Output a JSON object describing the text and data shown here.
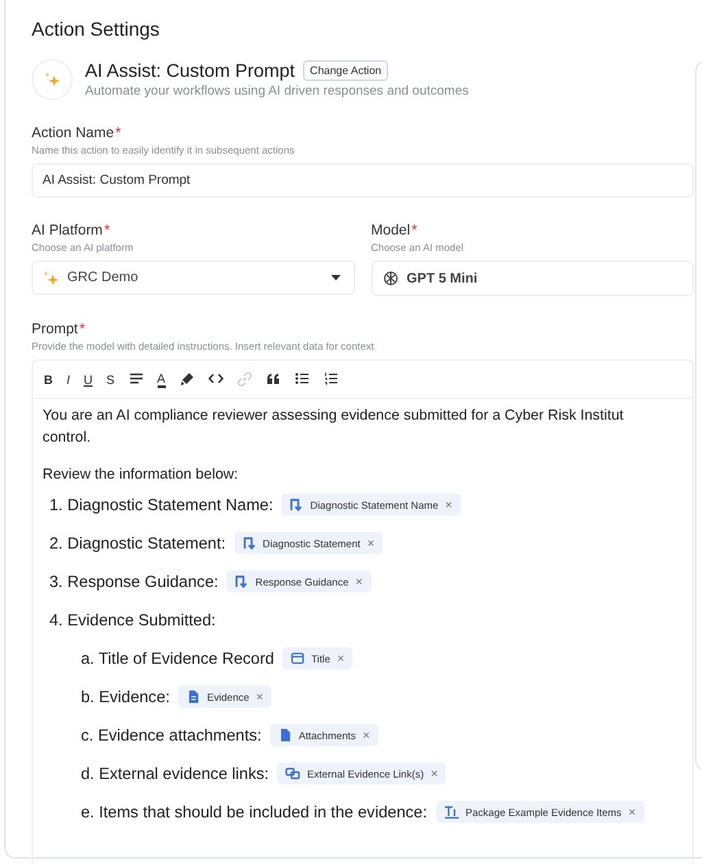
{
  "panel": {
    "title": "Action Settings"
  },
  "action": {
    "title": "AI Assist: Custom Prompt",
    "change_button": "Change Action",
    "description": "Automate your workflows using AI driven responses and outcomes"
  },
  "action_name": {
    "label": "Action Name",
    "required_mark": "*",
    "helper": "Name this action to easily identify it in subsequent actions",
    "value": "AI Assist: Custom Prompt"
  },
  "selectors": [
    {
      "kind": "select",
      "label": "AI Platform",
      "required_mark": "*",
      "helper": "Choose an AI platform",
      "value": "GRC Demo"
    },
    {
      "kind": "text",
      "label": "Model",
      "required_mark": "*",
      "helper": "Choose an AI model",
      "value": "GPT 5 Mini"
    }
  ],
  "prompt": {
    "label": "Prompt",
    "required_mark": "*",
    "helper": "Provide the model with detailed instructions. Insert relevant data for context",
    "toolbar": [
      {
        "kind": "bold",
        "label": "B",
        "disabled": false
      },
      {
        "kind": "italic",
        "label": "I",
        "disabled": false
      },
      {
        "kind": "underline",
        "label": "U",
        "disabled": false
      },
      {
        "kind": "strike",
        "label": "S",
        "disabled": false
      },
      {
        "kind": "align",
        "disabled": false
      },
      {
        "kind": "color",
        "label": "A",
        "disabled": false
      },
      {
        "kind": "highlight",
        "disabled": false
      },
      {
        "kind": "code",
        "disabled": false
      },
      {
        "kind": "link",
        "disabled": true
      },
      {
        "kind": "quote",
        "disabled": false
      },
      {
        "kind": "bullets",
        "disabled": false
      },
      {
        "kind": "numbers",
        "disabled": false
      }
    ],
    "intro": [
      "You are an AI compliance reviewer assessing evidence submitted for a Cyber Risk Institut",
      "control."
    ],
    "lead": "Review the information below:",
    "items": [
      {
        "marker": "1.",
        "text": "Diagnostic Statement Name:",
        "chip": {
          "kind": "lookup",
          "label": "Diagnostic Statement Name",
          "remove": "×"
        }
      },
      {
        "marker": "2.",
        "text": "Diagnostic Statement:",
        "chip": {
          "kind": "lookup",
          "label": "Diagnostic Statement",
          "remove": "×"
        }
      },
      {
        "marker": "3.",
        "text": "Response Guidance:",
        "chip": {
          "kind": "lookup",
          "label": "Response Guidance",
          "remove": "×"
        }
      },
      {
        "marker": "4.",
        "text": "Evidence Submitted:",
        "children": [
          {
            "marker": "a.",
            "text": "Title of Evidence Record",
            "chip": {
              "kind": "window",
              "label": "Title",
              "remove": "×"
            }
          },
          {
            "marker": "b.",
            "text": "Evidence:",
            "chip": {
              "kind": "document",
              "label": "Evidence",
              "remove": "×"
            }
          },
          {
            "marker": "c.",
            "text": "Evidence attachments:",
            "chip": {
              "kind": "file",
              "label": "Attachments",
              "remove": "×"
            }
          },
          {
            "marker": "d.",
            "text": "External evidence links:",
            "chip": {
              "kind": "link",
              "label": "External Evidence Link(s)",
              "remove": "×"
            }
          },
          {
            "marker": "e.",
            "text": "Items that should be included in the evidence:",
            "chip": {
              "kind": "text",
              "label": "Package Example Evidence Items",
              "remove": "×"
            }
          }
        ]
      }
    ]
  }
}
